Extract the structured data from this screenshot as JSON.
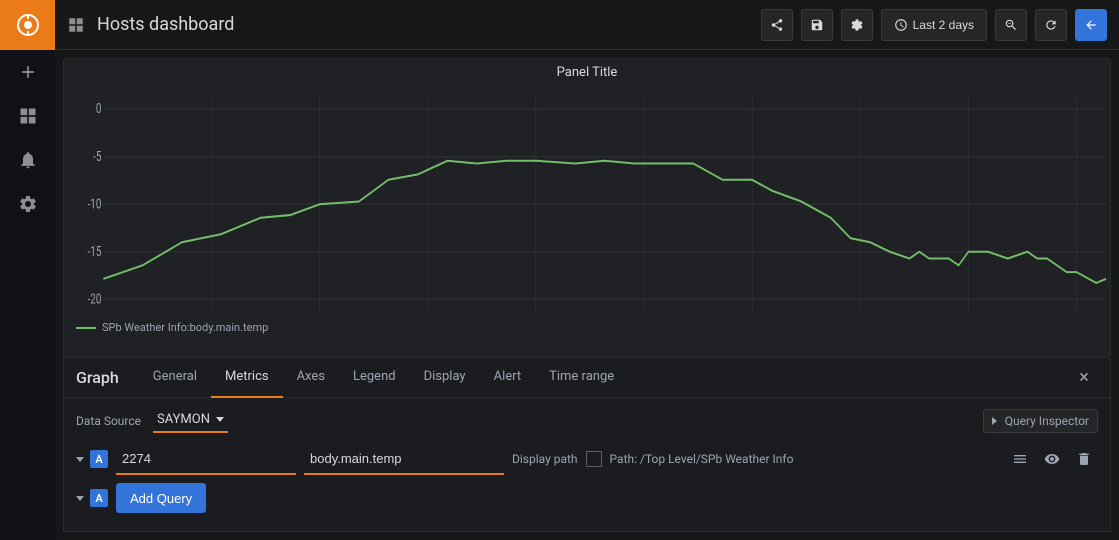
{
  "sidebar": {
    "logo_label": "Grafana",
    "items": [
      {
        "label": "Add panel",
        "icon": "plus-icon"
      },
      {
        "label": "Dashboards",
        "icon": "grid-icon"
      },
      {
        "label": "Alerting",
        "icon": "bell-icon"
      },
      {
        "label": "Configuration",
        "icon": "gear-icon"
      }
    ]
  },
  "topbar": {
    "title": "Hosts dashboard",
    "buttons": {
      "share_label": "Share",
      "save_label": "Save",
      "settings_label": "Settings",
      "time_range": "Last 2 days",
      "zoom_label": "Zoom out",
      "refresh_label": "Refresh",
      "back_label": "Back"
    }
  },
  "chart": {
    "title": "Panel Title",
    "y_labels": [
      "0",
      "-5",
      "-10",
      "-15",
      "-20"
    ],
    "legend_label": "SPb Weather Info:body.main.temp"
  },
  "edit_panel": {
    "title": "Graph",
    "tabs": [
      {
        "label": "General",
        "active": false
      },
      {
        "label": "Metrics",
        "active": true
      },
      {
        "label": "Axes",
        "active": false
      },
      {
        "label": "Legend",
        "active": false
      },
      {
        "label": "Display",
        "active": false
      },
      {
        "label": "Alert",
        "active": false
      },
      {
        "label": "Time range",
        "active": false
      }
    ],
    "close_label": "×"
  },
  "query_section": {
    "datasource_label": "Data Source",
    "datasource_value": "SAYMON",
    "query_inspector_label": "Query Inspector",
    "query_row": {
      "letter": "A",
      "id_value": "2274",
      "id_placeholder": "",
      "path_value": "body.main.temp",
      "path_placeholder": "",
      "display_path_label": "Display path",
      "path_full": "Path: /Top Level/SPb Weather Info"
    },
    "add_query_label": "Add Query"
  }
}
